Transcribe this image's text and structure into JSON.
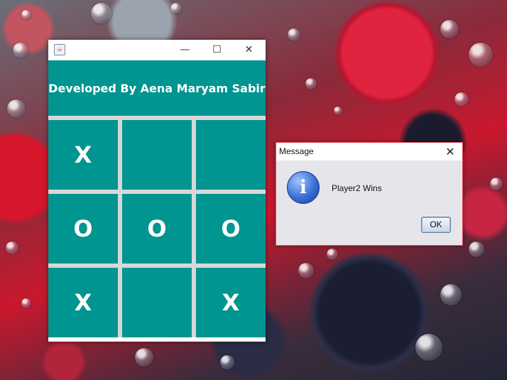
{
  "game_window": {
    "minimize_glyph": "—",
    "maximize_glyph": "☐",
    "close_glyph": "✕",
    "header_text": "Developed By Aena Maryam Sabir",
    "cells": [
      "X",
      "",
      "",
      "O",
      "O",
      "O",
      "X",
      "",
      "X"
    ]
  },
  "dialog": {
    "title": "Message",
    "close_glyph": "✕",
    "icon": "info-icon",
    "icon_glyph": "i",
    "message": "Player2 Wins",
    "ok_label": "OK"
  },
  "colors": {
    "teal": "#009590",
    "grid_gap": "#d8d8d8"
  }
}
